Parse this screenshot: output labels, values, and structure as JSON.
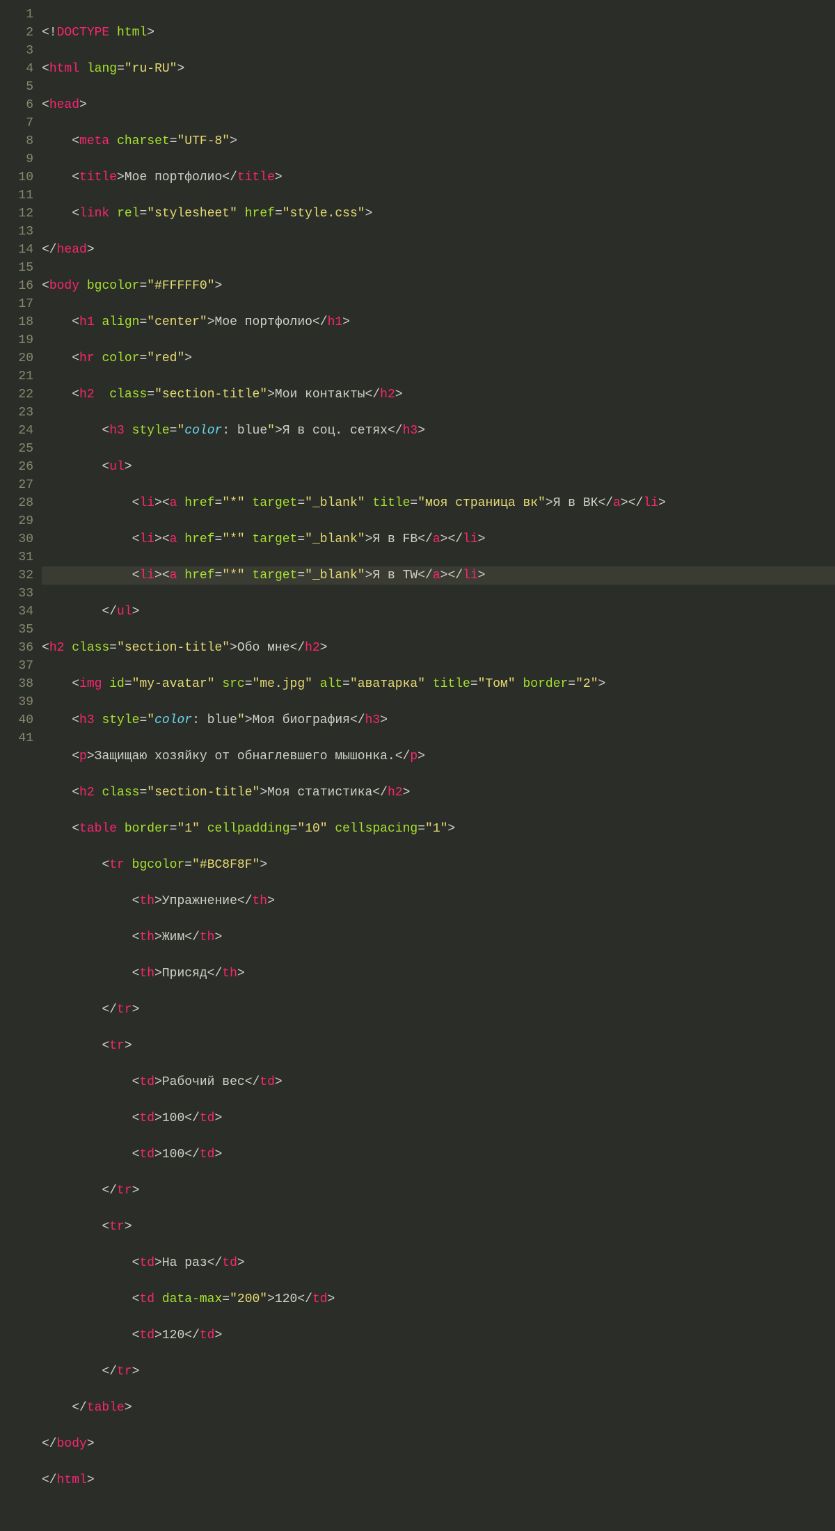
{
  "colors": {
    "bg": "#2b2d28",
    "gutter": "#888870",
    "tag": "#f92672",
    "attr": "#a6e22e",
    "string": "#e6db74",
    "text": "#d0d0c8",
    "keyword": "#66d9ef"
  },
  "gutter": [
    "1",
    "2",
    "3",
    "4",
    "5",
    "6",
    "7",
    "8",
    "9",
    "10",
    "11",
    "12",
    "13",
    "14",
    "15",
    "16",
    "17",
    "18",
    "19",
    "20",
    "21",
    "22",
    "23",
    "24",
    "25",
    "26",
    "27",
    "28",
    "29",
    "30",
    "31",
    "32",
    "33",
    "34",
    "35",
    "36",
    "37",
    "38",
    "39",
    "40",
    "41"
  ],
  "highlighted_line": 16,
  "code": {
    "l1": {
      "pre": "",
      "doctype": "<!",
      "kw": "DOCTYPE",
      "sp": " ",
      "attr": "html",
      "close": ">"
    },
    "l2": {
      "pre": "",
      "open": "<",
      "tag": "html",
      "sp": " ",
      "attr": "lang",
      "eq": "=",
      "str": "\"ru-RU\"",
      "close": ">"
    },
    "l3": {
      "pre": "",
      "open": "<",
      "tag": "head",
      "close": ">"
    },
    "l4": {
      "pre": "    ",
      "open": "<",
      "tag": "meta",
      "sp": " ",
      "attr": "charset",
      "eq": "=",
      "str": "\"UTF-8\"",
      "close": ">"
    },
    "l5": {
      "pre": "    ",
      "open": "<",
      "tag": "title",
      "close": ">",
      "txt": "Мое портфолио",
      "open2": "</",
      "tag2": "title",
      "close2": ">"
    },
    "l6": {
      "pre": "    ",
      "open": "<",
      "tag": "link",
      "sp": " ",
      "attr": "rel",
      "eq": "=",
      "str": "\"stylesheet\"",
      "sp2": " ",
      "attr2": "href",
      "eq2": "=",
      "str2": "\"style.css\"",
      "close": ">"
    },
    "l7": {
      "pre": "",
      "open": "</",
      "tag": "head",
      "close": ">"
    },
    "l8": {
      "pre": "",
      "open": "<",
      "tag": "body",
      "sp": " ",
      "attr": "bgcolor",
      "eq": "=",
      "str": "\"#FFFFF0\"",
      "close": ">"
    },
    "l9": {
      "pre": "    ",
      "open": "<",
      "tag": "h1",
      "sp": " ",
      "attr": "align",
      "eq": "=",
      "str": "\"center\"",
      "close": ">",
      "txt": "Мое портфолио",
      "open2": "</",
      "tag2": "h1",
      "close2": ">"
    },
    "l10": {
      "pre": "    ",
      "open": "<",
      "tag": "hr",
      "sp": " ",
      "attr": "color",
      "eq": "=",
      "str": "\"red\"",
      "close": ">"
    },
    "l11": {
      "pre": "    ",
      "open": "<",
      "tag": "h2",
      "sp": "  ",
      "attr": "class",
      "eq": "=",
      "str": "\"section-title\"",
      "close": ">",
      "txt": "Мои контакты",
      "open2": "</",
      "tag2": "h2",
      "close2": ">"
    },
    "l12": {
      "pre": "        ",
      "open": "<",
      "tag": "h3",
      "sp": " ",
      "attrstyle": "style",
      "eq": "=",
      "q1": "\"",
      "prop": "color",
      "colon": ": ",
      "val": "blue",
      "q2": "\"",
      "close": ">",
      "txt": "Я в соц. сетях",
      "open2": "</",
      "tag2": "h3",
      "close2": ">"
    },
    "l13": {
      "pre": "        ",
      "open": "<",
      "tag": "ul",
      "close": ">"
    },
    "l14": {
      "pre": "            ",
      "open": "<",
      "tag": "li",
      "close": ">",
      "open2": "<",
      "tag2": "a",
      "sp": " ",
      "attr": "href",
      "eq": "=",
      "str": "\"*\"",
      "sp2": " ",
      "attr2": "target",
      "eq2": "=",
      "str2": "\"_blank\"",
      "sp3": " ",
      "attr3": "title",
      "eq3": "=",
      "str3": "\"моя страница вк\"",
      "close2": ">",
      "txt": "Я в ВК",
      "open3": "</",
      "tag3": "a",
      "close3": ">",
      "open4": "</",
      "tag4": "li",
      "close4": ">"
    },
    "l15": {
      "pre": "            ",
      "open": "<",
      "tag": "li",
      "close": ">",
      "open2": "<",
      "tag2": "a",
      "sp": " ",
      "attr": "href",
      "eq": "=",
      "str": "\"*\"",
      "sp2": " ",
      "attr2": "target",
      "eq2": "=",
      "str2": "\"_blank\"",
      "close2": ">",
      "txt": "Я в FB",
      "open3": "</",
      "tag3": "a",
      "close3": ">",
      "open4": "</",
      "tag4": "li",
      "close4": ">"
    },
    "l16": {
      "pre": "            ",
      "open": "<",
      "tag": "li",
      "close": ">",
      "open2": "<",
      "tag2": "a",
      "sp": " ",
      "attr": "href",
      "eq": "=",
      "str": "\"*\"",
      "sp2": " ",
      "attr2": "target",
      "eq2": "=",
      "str2": "\"_blank\"",
      "close2": ">",
      "txt": "Я в TW",
      "open3": "</",
      "tag3": "a",
      "close3": ">",
      "open4": "</",
      "tag4": "li",
      "close4": ">"
    },
    "l17": {
      "pre": "        ",
      "open": "</",
      "tag": "ul",
      "close": ">"
    },
    "l18": {
      "pre": "",
      "open": "<",
      "tag": "h2",
      "sp": " ",
      "attr": "class",
      "eq": "=",
      "str": "\"section-title\"",
      "close": ">",
      "txt": "Обо мне",
      "open2": "</",
      "tag2": "h2",
      "close2": ">"
    },
    "l19": {
      "pre": "    ",
      "open": "<",
      "tag": "img",
      "sp": " ",
      "attr": "id",
      "eq": "=",
      "str": "\"my-avatar\"",
      "sp2": " ",
      "attr2": "src",
      "eq2": "=",
      "str2": "\"me.jpg\"",
      "sp3": " ",
      "attr3": "alt",
      "eq3": "=",
      "str3": "\"аватарка\"",
      "sp4": " ",
      "attr4": "title",
      "eq4": "=",
      "str4": "\"Том\"",
      "sp5": " ",
      "attr5": "border",
      "eq5": "=",
      "str5": "\"2\"",
      "close": ">"
    },
    "l20": {
      "pre": "    ",
      "open": "<",
      "tag": "h3",
      "sp": " ",
      "attrstyle": "style",
      "eq": "=",
      "q1": "\"",
      "prop": "color",
      "colon": ": ",
      "val": "blue",
      "q2": "\"",
      "close": ">",
      "txt": "Моя биография",
      "open2": "</",
      "tag2": "h3",
      "close2": ">"
    },
    "l21": {
      "pre": "    ",
      "open": "<",
      "tag": "p",
      "close": ">",
      "txt": "Защищаю хозяйку от обнаглевшего мышонка.",
      "open2": "</",
      "tag2": "p",
      "close2": ">"
    },
    "l22": {
      "pre": "    ",
      "open": "<",
      "tag": "h2",
      "sp": " ",
      "attr": "class",
      "eq": "=",
      "str": "\"section-title\"",
      "close": ">",
      "txt": "Моя статистика",
      "open2": "</",
      "tag2": "h2",
      "close2": ">"
    },
    "l23": {
      "pre": "    ",
      "open": "<",
      "tag": "table",
      "sp": " ",
      "attr": "border",
      "eq": "=",
      "str": "\"1\"",
      "sp2": " ",
      "attr2": "cellpadding",
      "eq2": "=",
      "str2": "\"10\"",
      "sp3": " ",
      "attr3": "cellspacing",
      "eq3": "=",
      "str3": "\"1\"",
      "close": ">"
    },
    "l24": {
      "pre": "        ",
      "open": "<",
      "tag": "tr",
      "sp": " ",
      "attr": "bgcolor",
      "eq": "=",
      "str": "\"#BC8F8F\"",
      "close": ">"
    },
    "l25": {
      "pre": "            ",
      "open": "<",
      "tag": "th",
      "close": ">",
      "txt": "Упражнение",
      "open2": "</",
      "tag2": "th",
      "close2": ">"
    },
    "l26": {
      "pre": "            ",
      "open": "<",
      "tag": "th",
      "close": ">",
      "txt": "Жим",
      "open2": "</",
      "tag2": "th",
      "close2": ">"
    },
    "l27": {
      "pre": "            ",
      "open": "<",
      "tag": "th",
      "close": ">",
      "txt": "Присяд",
      "open2": "</",
      "tag2": "th",
      "close2": ">"
    },
    "l28": {
      "pre": "        ",
      "open": "</",
      "tag": "tr",
      "close": ">"
    },
    "l29": {
      "pre": "        ",
      "open": "<",
      "tag": "tr",
      "close": ">"
    },
    "l30": {
      "pre": "            ",
      "open": "<",
      "tag": "td",
      "close": ">",
      "txt": "Рабочий вес",
      "open2": "</",
      "tag2": "td",
      "close2": ">"
    },
    "l31": {
      "pre": "            ",
      "open": "<",
      "tag": "td",
      "close": ">",
      "txt": "100",
      "open2": "</",
      "tag2": "td",
      "close2": ">"
    },
    "l32": {
      "pre": "            ",
      "open": "<",
      "tag": "td",
      "close": ">",
      "txt": "100",
      "open2": "</",
      "tag2": "td",
      "close2": ">"
    },
    "l33": {
      "pre": "        ",
      "open": "</",
      "tag": "tr",
      "close": ">"
    },
    "l34": {
      "pre": "        ",
      "open": "<",
      "tag": "tr",
      "close": ">"
    },
    "l35": {
      "pre": "            ",
      "open": "<",
      "tag": "td",
      "close": ">",
      "txt": "На раз",
      "open2": "</",
      "tag2": "td",
      "close2": ">"
    },
    "l36": {
      "pre": "            ",
      "open": "<",
      "tag": "td",
      "sp": " ",
      "attr": "data-max",
      "eq": "=",
      "str": "\"200\"",
      "close": ">",
      "txt": "120",
      "open2": "</",
      "tag2": "td",
      "close2": ">"
    },
    "l37": {
      "pre": "            ",
      "open": "<",
      "tag": "td",
      "close": ">",
      "txt": "120",
      "open2": "</",
      "tag2": "td",
      "close2": ">"
    },
    "l38": {
      "pre": "        ",
      "open": "</",
      "tag": "tr",
      "close": ">"
    },
    "l39": {
      "pre": "    ",
      "open": "</",
      "tag": "table",
      "close": ">"
    },
    "l40": {
      "pre": "",
      "open": "</",
      "tag": "body",
      "close": ">"
    },
    "l41": {
      "pre": "",
      "open": "</",
      "tag": "html",
      "close": ">"
    }
  }
}
